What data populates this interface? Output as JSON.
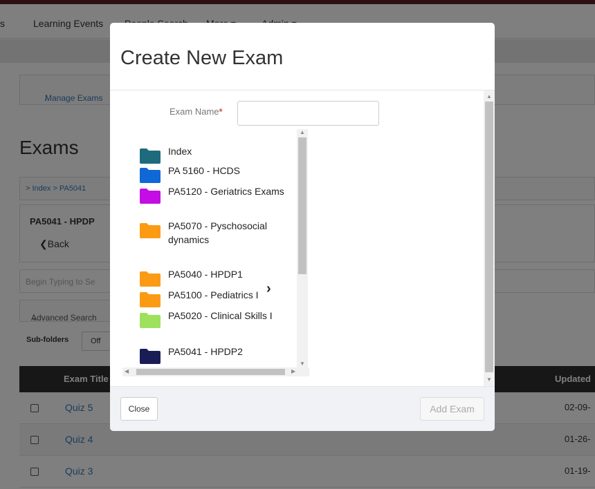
{
  "navbar": {
    "items": [
      {
        "label": "s"
      },
      {
        "label": "Learning Events"
      },
      {
        "label": "People Search"
      },
      {
        "label": "More ▾"
      },
      {
        "label": "Admin ▾"
      }
    ]
  },
  "breadcrumb": {
    "separator": "/",
    "current": "Manage Exams"
  },
  "page": {
    "title": "Exams"
  },
  "folder_path": {
    "text": "> Index > PA5041"
  },
  "folder_panel": {
    "name": "PA5041 - HPDP",
    "back_label": "Back"
  },
  "search": {
    "placeholder": "Begin Typing to Se"
  },
  "advanced_search": {
    "label": "Advanced Search"
  },
  "subfolders": {
    "label": "Sub-folders",
    "toggle_label": "Off"
  },
  "table": {
    "headers": [
      {
        "label": "Exam Title"
      },
      {
        "label": "Updated"
      }
    ],
    "rows": [
      {
        "name": "Quiz 5",
        "date": "02-09-"
      },
      {
        "name": "Quiz 4",
        "date": "01-26-"
      },
      {
        "name": "Quiz 3",
        "date": "01-19-"
      }
    ]
  },
  "modal": {
    "title": "Create New Exam",
    "exam_name_label": "Exam Name",
    "required_mark": "*",
    "exam_name_value": "",
    "folders": [
      {
        "label": "Index",
        "color": "#1d6b7c"
      },
      {
        "label": "PA 5160 - HCDS",
        "color": "#0f68d6"
      },
      {
        "label": "PA5120 - Geriatrics Exams",
        "color": "#c40de4"
      },
      {
        "label": "PA5070 - Pyschosocial dynamics",
        "color": "#fb9b13"
      },
      {
        "label": "PA5040 - HPDP1",
        "color": "#fb9b13"
      },
      {
        "label": "PA5100 - Pediatrics I",
        "color": "#fb9b13"
      },
      {
        "label": "PA5020 - Clinical Skills I",
        "color": "#9ee15c"
      },
      {
        "label": "PA5041 - HPDP2",
        "color": "#1a1d55"
      }
    ],
    "close_label": "Close",
    "add_label": "Add Exam"
  },
  "colors": {
    "link": "#337ab7",
    "required": "#d9534f",
    "header_bar": "#5a2026",
    "table_head": "#2f2f2f"
  }
}
